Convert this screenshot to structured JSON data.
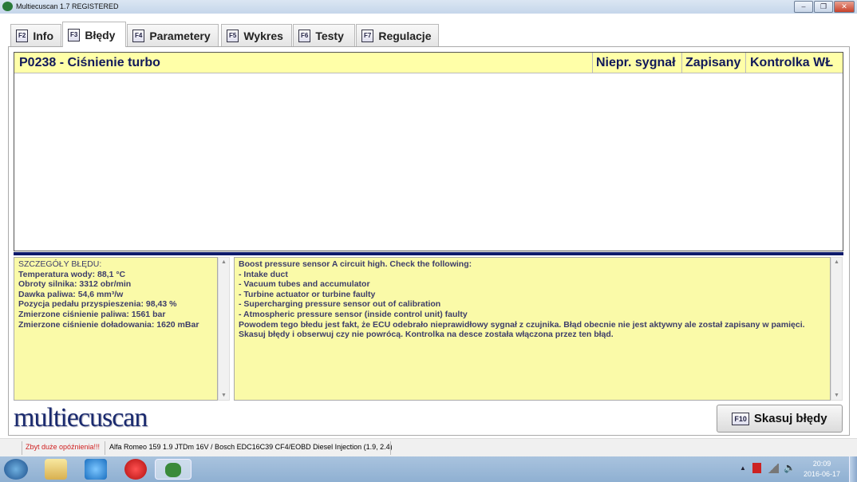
{
  "window": {
    "title": "Multiecuscan 1.7 REGISTERED"
  },
  "tabs": [
    {
      "key": "F2",
      "label": "Info"
    },
    {
      "key": "F3",
      "label": "Błędy",
      "active": true
    },
    {
      "key": "F4",
      "label": "Parametery"
    },
    {
      "key": "F5",
      "label": "Wykres"
    },
    {
      "key": "F6",
      "label": "Testy"
    },
    {
      "key": "F7",
      "label": "Regulacje"
    }
  ],
  "errors": {
    "code_title": "P0238 - Ciśnienie turbo",
    "columns": [
      "Niepr. sygnał",
      "Zapisany",
      "Kontrolka WŁ"
    ]
  },
  "details": {
    "lines": [
      "SZCZEGÓŁY BŁĘDU:",
      "Temperatura wody: 88,1 °C",
      "Obroty silnika: 3312 obr/min",
      "Dawka paliwa: 54,6 mm³/w",
      "Pozycja pedału przyspieszenia: 98,43 %",
      "Zmierzone ciśnienie paliwa: 1561 bar",
      "Zmierzone ciśnienie doładowania: 1620 mBar"
    ]
  },
  "description": {
    "lines": [
      "Boost pressure sensor A circuit high. Check the following:",
      "- Intake duct",
      "- Vacuum tubes and accumulator",
      "- Turbine actuator or turbine faulty",
      "- Supercharging pressure sensor out of calibration",
      "- Atmospheric pressure sensor (inside control unit) faulty",
      "Powodem tego błedu jest fakt, że ECU odebrało nieprawidłowy sygnał z czujnika. Błąd obecnie nie jest aktywny ale został zapisany w pamięci.",
      "Skasuj błędy i obserwuj czy nie powrócą. Kontrolka na desce została włączona przez ten błąd."
    ]
  },
  "logo": "multiecuscan",
  "clear_button": {
    "key": "F10",
    "label": "Skasuj błędy"
  },
  "status": {
    "warning": "Zbyt duże opóźnienia!!!",
    "vehicle": "Alfa Romeo 159 1.9 JTDm 16V / Bosch EDC16C39 CF4/EOBD Diesel Injection (1.9, 2.4)"
  },
  "clock": {
    "time": "20:09",
    "date": "2016-06-17"
  }
}
